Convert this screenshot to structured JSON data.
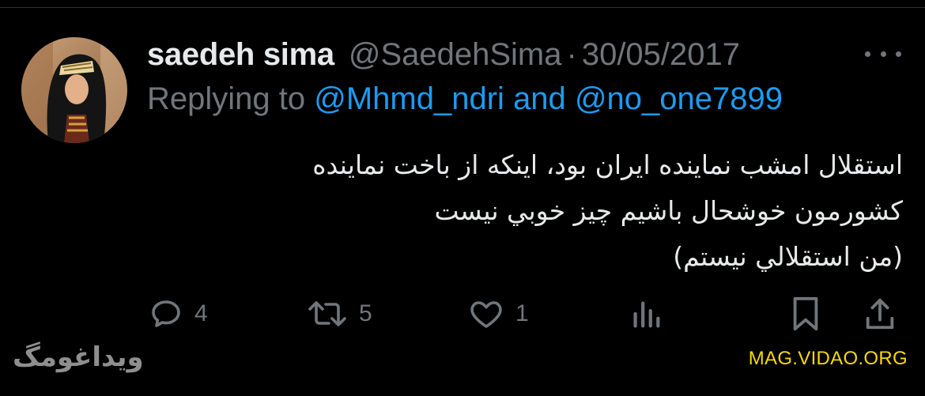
{
  "tweet": {
    "display_name": "saedeh sima",
    "handle": "@SaedehSima",
    "separator": "·",
    "date": "30/05/2017",
    "replying_prefix": "Replying to",
    "replying_to_1": "@Mhmd_ndri",
    "replying_and": "and",
    "replying_to_2": "@no_one7899",
    "text_lines": [
      "استقلال امشب نماينده ايران بود، اینکه از باخت نماينده",
      "كشورمون خوشحال باشيم چيز خوبي نيست",
      "(من استقلالي نيستم)"
    ],
    "more_icon": "more-horizontal-icon",
    "actions": {
      "reply_count": "4",
      "retweet_count": "5",
      "like_count": "1",
      "views_icon": "analytics-icon",
      "bookmark_icon": "bookmark-icon",
      "share_icon": "share-icon"
    }
  },
  "watermarks": {
    "left": "ويداغومگ",
    "right": "MAG.VIDAO.ORG"
  },
  "colors": {
    "background": "#000000",
    "text": "#e7e9ea",
    "muted": "#71767b",
    "link": "#1d9bf0",
    "watermark_right": "#f5d90a"
  }
}
